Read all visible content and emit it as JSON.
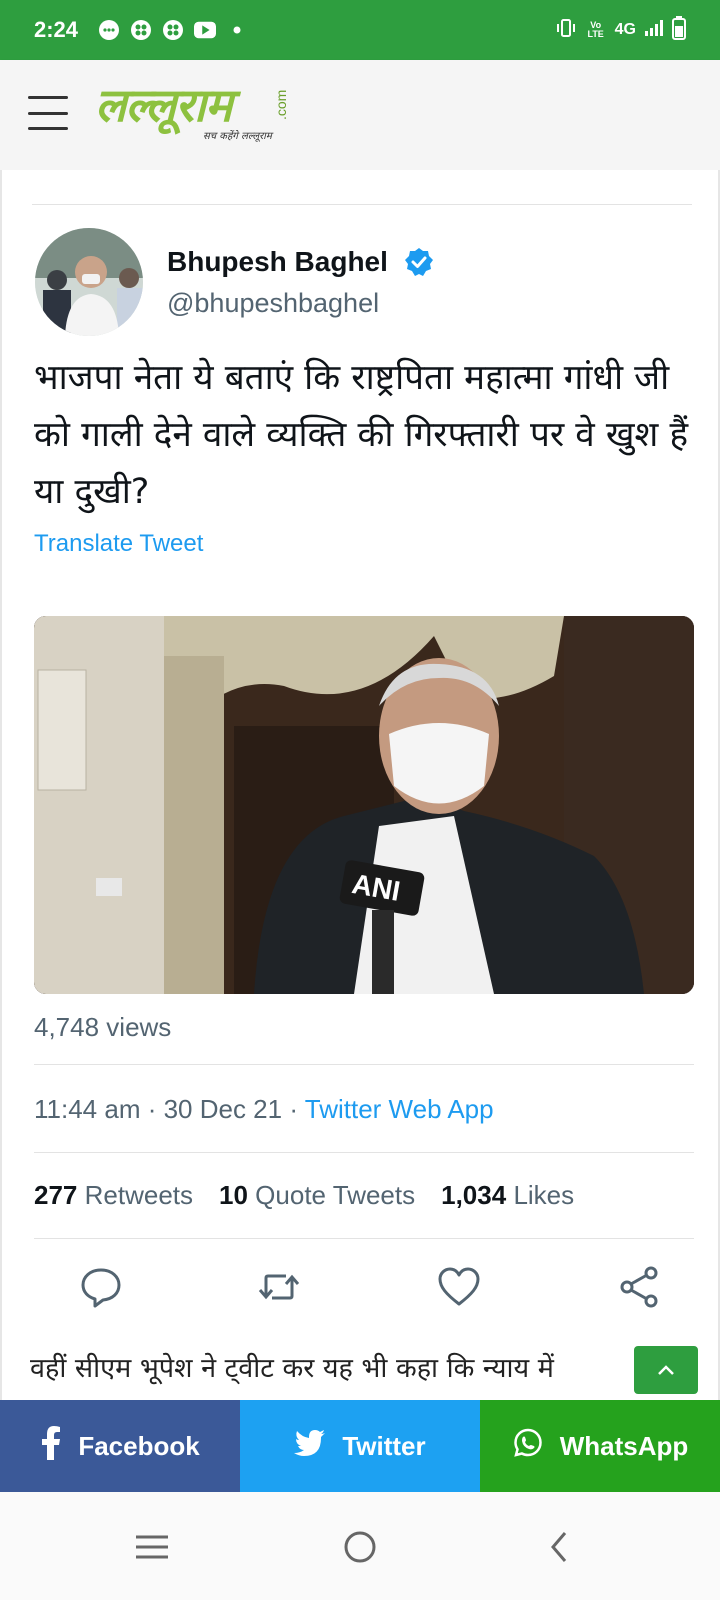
{
  "status_bar": {
    "time": "2:24",
    "network": "4G",
    "volte": "Vo LTE",
    "icons": [
      "messages-icon",
      "app-icon",
      "app-icon",
      "youtube-icon",
      "dot-icon"
    ]
  },
  "header": {
    "logo_text": "लल्लूराम",
    "logo_domain": ".com",
    "logo_tagline": "सच कहेंगे लल्लूराम",
    "brand_color": "#8dc13f"
  },
  "tweet": {
    "author_name": "Bhupesh Baghel",
    "handle": "@bhupeshbaghel",
    "text": "भाजपा नेता ये बताएं कि राष्ट्रपिता महात्मा गांधी जी को गाली देने वाले व्यक्ति की गिरफ्तारी पर वे खुश हैं या दुखी?",
    "translate_label": "Translate Tweet",
    "media_badge": "ANI",
    "views": "4,748 views",
    "time": "11:44 am · 30 Dec 21 · ",
    "source": "Twitter Web App",
    "retweets_count": "277",
    "retweets_label": "Retweets",
    "quotes_count": "10",
    "quotes_label": "Quote Tweets",
    "likes_count": "1,034",
    "likes_label": "Likes"
  },
  "article": {
    "paragraph": "वहीं सीएम भूपेश ने ट्वीट कर यह भी कहा कि न्याय में"
  },
  "share_bar": {
    "facebook": "Facebook",
    "twitter": "Twitter",
    "whatsapp": "WhatsApp",
    "facebook_color": "#3b5998",
    "twitter_color": "#1da1f2",
    "whatsapp_color": "#25a21d"
  },
  "colors": {
    "status_bar": "#2e9e3f",
    "twitter_blue": "#1d9bf0"
  }
}
